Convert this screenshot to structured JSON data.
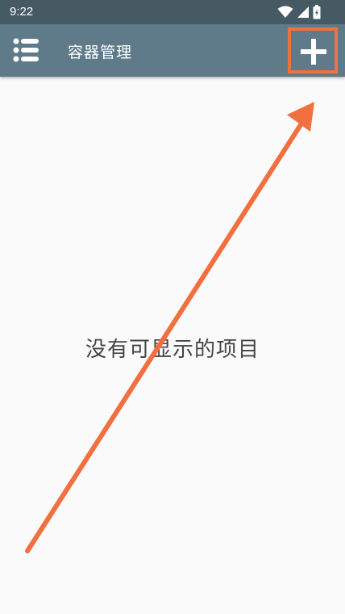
{
  "status_bar": {
    "time": "9:22",
    "icons": [
      "wifi-icon",
      "signal-icon",
      "battery-icon"
    ]
  },
  "toolbar": {
    "title": "容器管理",
    "menu_icon": "menu-list-icon",
    "add_icon": "plus-icon"
  },
  "main": {
    "empty_message": "没有可显示的项目"
  },
  "colors": {
    "status_bar_bg": "#465a64",
    "toolbar_bg": "#5f7b89",
    "background": "#fafafa",
    "highlight": "#f26f3f",
    "empty_text": "#444444"
  }
}
